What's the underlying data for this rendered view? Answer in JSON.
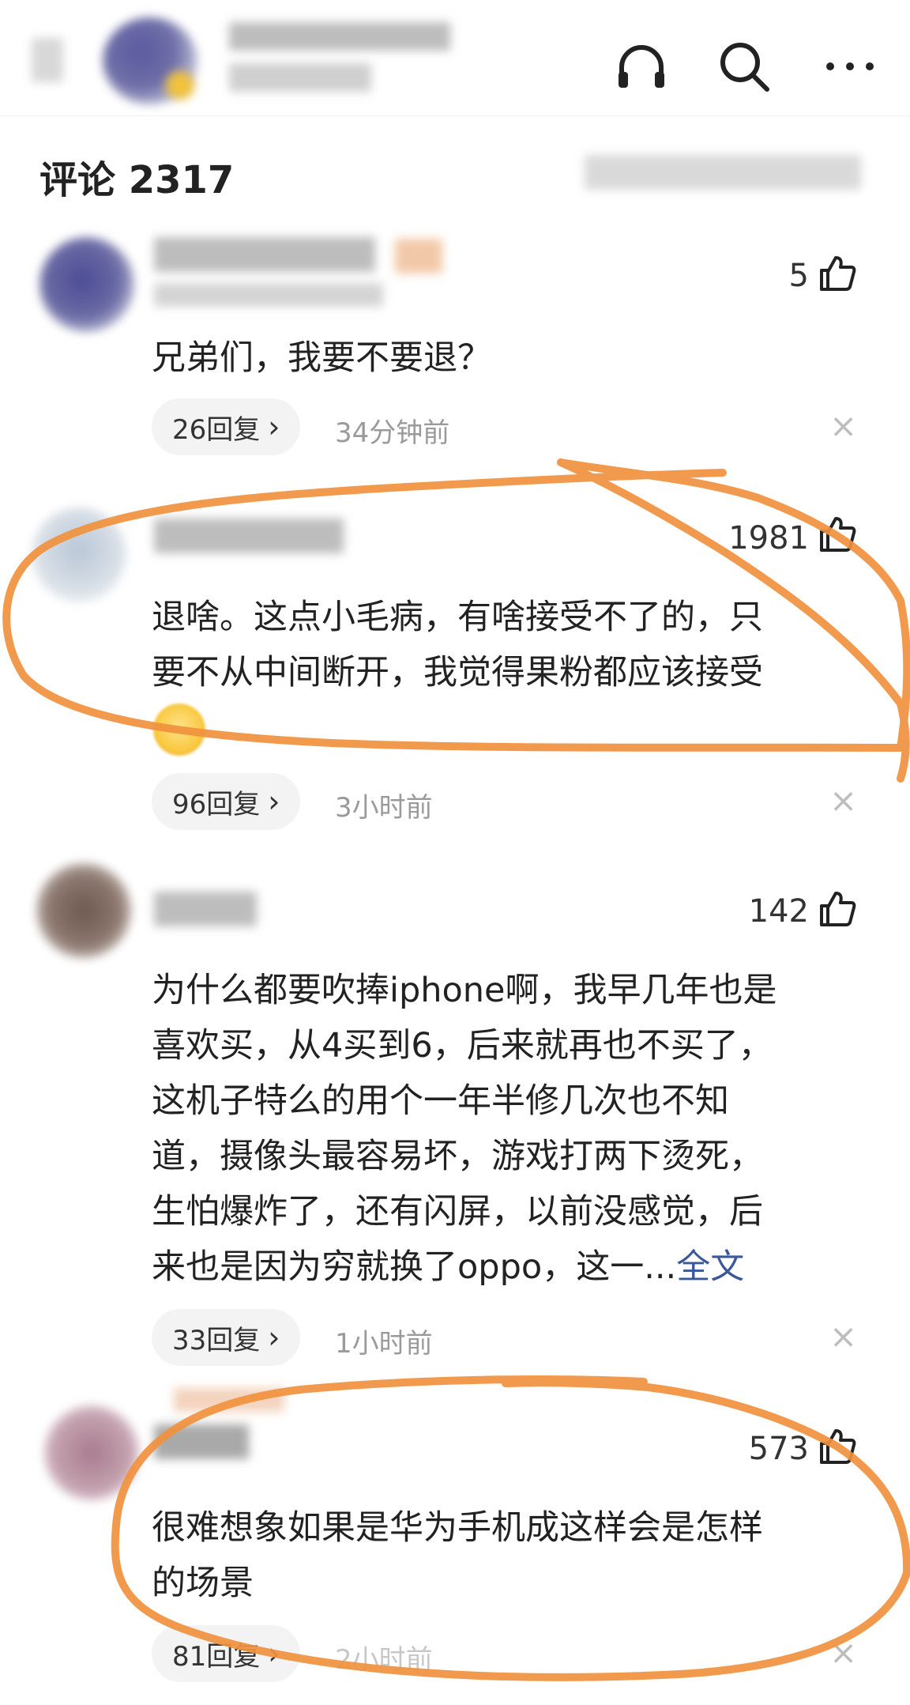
{
  "colors": {
    "accent_link": "#3b5998",
    "annotation": "#f0913e",
    "muted_text": "#9a9a9a",
    "pill_bg": "#f3f3f3"
  },
  "header": {
    "icons": [
      "back-icon",
      "headphones-icon",
      "search-icon",
      "more-icon"
    ]
  },
  "comments_header": {
    "title": "评论 2317"
  },
  "comments": [
    {
      "likes": "5",
      "text": "兄弟们，我要不要退？",
      "replies": "26回复",
      "time": "34分钟前"
    },
    {
      "likes": "1981",
      "text_line1": "退啥。这点小毛病，有啥接受不了的，只",
      "text_line2": "要不从中间断开，我觉得果粉都应该接受",
      "replies": "96回复",
      "time": "3小时前"
    },
    {
      "likes": "142",
      "lines": [
        "为什么都要吹捧iphone啊，我早几年也是",
        "喜欢买，从4买到6，后来就再也不买了，",
        "这机子特么的用个一年半修几次也不知",
        "道，摄像头最容易坏，游戏打两下烫死，",
        "生怕爆炸了，还有闪屏，以前没感觉，后"
      ],
      "last_line": "来也是因为穷就换了oppo，这一...",
      "more_link": "全文",
      "replies": "33回复",
      "time": "1小时前"
    },
    {
      "likes": "573",
      "text_line1": "很难想象如果是华为手机成这样会是怎样",
      "text_line2": "的场景",
      "replies": "81回复",
      "time": "2小时前"
    }
  ],
  "reply_chevron": "›",
  "dismiss_glyph": "×"
}
